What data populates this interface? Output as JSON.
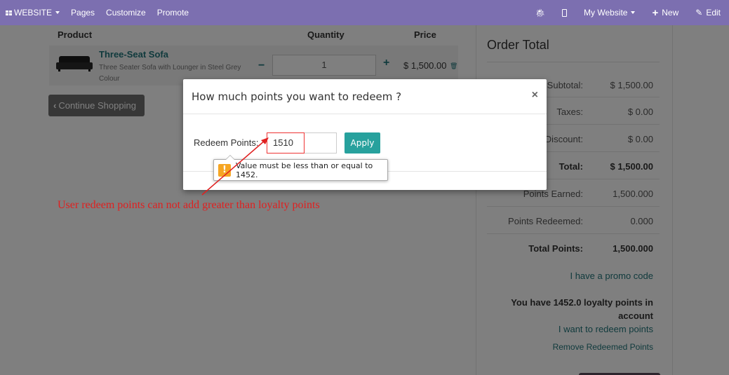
{
  "navbar": {
    "website_label": "WEBSITE",
    "pages_label": "Pages",
    "customize_label": "Customize",
    "promote_label": "Promote",
    "my_website_label": "My Website",
    "new_label": "New",
    "edit_label": "Edit",
    "bg_color": "#7c6fb0"
  },
  "cart": {
    "headers": {
      "product": "Product",
      "quantity": "Quantity",
      "price": "Price"
    },
    "item": {
      "name": "Three-Seat Sofa",
      "description": "Three Seater Sofa with Lounger in Steel Grey Colour",
      "quantity": "1",
      "price": "$ 1,500.00"
    },
    "continue_label": "Continue Shopping"
  },
  "order_total": {
    "title": "Order Total",
    "rows": [
      {
        "label": "Subtotal:",
        "value": "$ 1,500.00"
      },
      {
        "label": "Taxes:",
        "value": "$ 0.00"
      },
      {
        "label": "Discount:",
        "value": "$ 0.00"
      },
      {
        "label": "Total:",
        "value": "$ 1,500.00"
      },
      {
        "label": "Points Earned:",
        "value": "1,500.000"
      },
      {
        "label": "Points Redeemed:",
        "value": "0.000"
      },
      {
        "label": "Total Points:",
        "value": "1,500.000"
      }
    ],
    "promo_link": "I have a promo code",
    "loyalty_message": "You have 1452.0 loyalty points in account",
    "redeem_link": "I want to redeem points",
    "remove_link": "Remove Redeemed Points"
  },
  "modal": {
    "title": "How much points you want to redeem ?",
    "close_symbol": "×",
    "redeem_label": "Redeem Points:",
    "redeem_value": "1510",
    "apply_label": "Apply",
    "tooltip_text": "Value must be less than or equal to 1452.",
    "accent_color": "#27a19d"
  },
  "annotation": {
    "text": "User redeem points can not add greater than loyalty points",
    "color": "#e02020"
  }
}
